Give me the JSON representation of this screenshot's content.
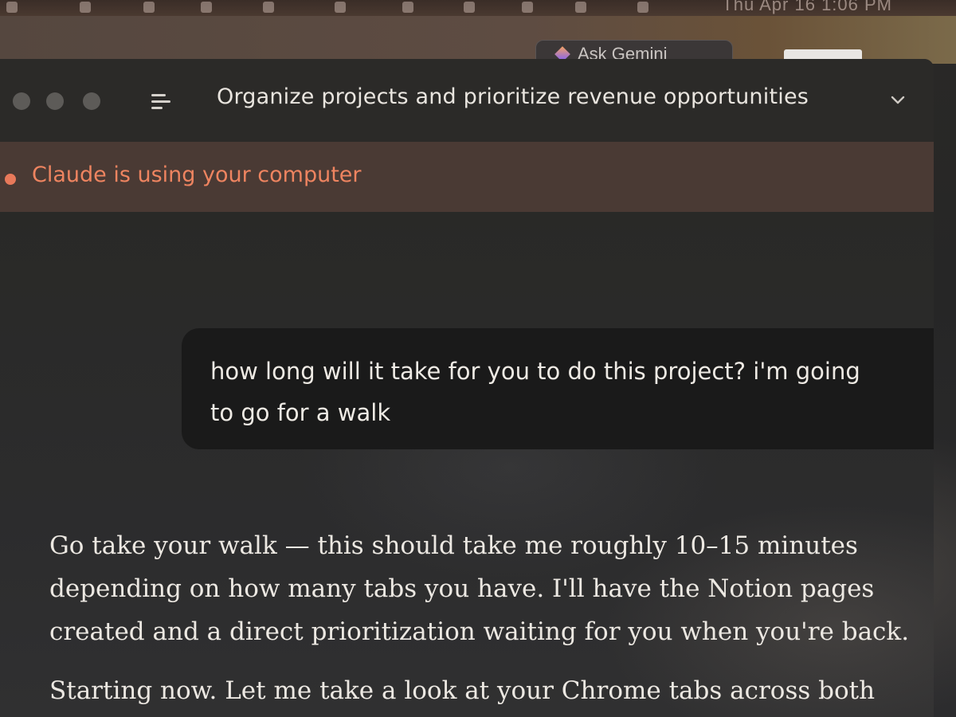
{
  "menubar": {
    "clock": "Thu Apr 16  1:06 PM"
  },
  "background_window": {
    "gemini_button": "Ask Gemini"
  },
  "window": {
    "title": "Organize projects and prioritize revenue opportunities"
  },
  "status_banner": {
    "text": "Claude is using your computer",
    "color": "#ee8460"
  },
  "conversation": {
    "user_message": "how long will it take for you to do this project? i'm going\nto go for a walk",
    "assistant_paragraphs": [
      "Go take your walk — this should take me roughly 10–15 minutes depending on how many tabs you have. I'll have the Notion pages created and a direct prioritization waiting for you when you're back.",
      "Starting now. Let me take a look at your Chrome tabs across both"
    ]
  },
  "icons": {
    "menu": "menu-lines-icon",
    "chevron": "chevron-down-icon",
    "status": "status-dot-icon"
  }
}
